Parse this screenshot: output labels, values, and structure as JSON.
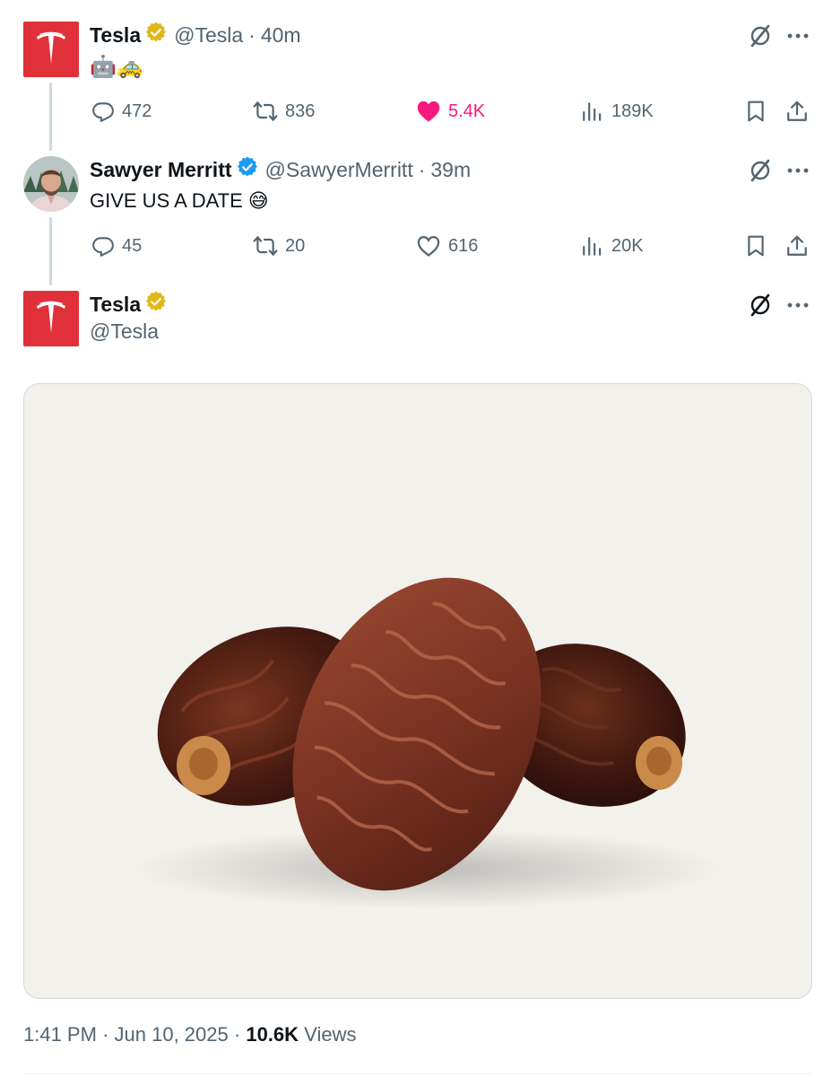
{
  "tweets": [
    {
      "name": "Tesla",
      "handle": "@Tesla",
      "separator": "·",
      "time": "40m",
      "text": "🤖🚕",
      "stats": {
        "replies": "472",
        "reposts": "836",
        "likes": "5.4K",
        "views": "189K"
      },
      "liked": true
    },
    {
      "name": "Sawyer Merritt",
      "handle": "@SawyerMerritt",
      "separator": "·",
      "time": "39m",
      "text": "GIVE US A DATE",
      "text_emoji": "😅",
      "stats": {
        "replies": "45",
        "reposts": "20",
        "likes": "616",
        "views": "20K"
      },
      "liked": false
    }
  ],
  "main_tweet": {
    "name": "Tesla",
    "handle": "@Tesla",
    "footer": {
      "time": "1:41 PM",
      "sep1": "·",
      "date": "Jun 10, 2025",
      "sep2": "·",
      "views": "10.6K",
      "views_label": "Views"
    }
  },
  "colors": {
    "tesla_red": "#e0313a",
    "gold_badge": "#e2b719",
    "blue_badge": "#1d9bf0",
    "like_pink": "#f91880",
    "muted": "#536471"
  },
  "icons": [
    "reply-icon",
    "repost-icon",
    "like-icon",
    "views-icon",
    "bookmark-icon",
    "share-icon",
    "grok-icon",
    "more-icon",
    "verified-badge-icon",
    "tesla-logo-icon"
  ]
}
